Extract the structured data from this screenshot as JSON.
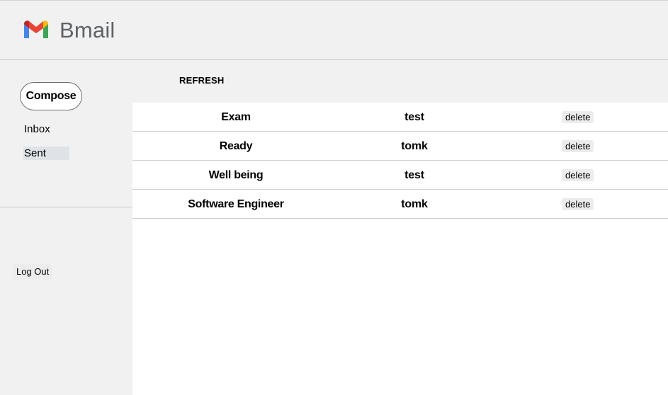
{
  "header": {
    "logo_icon": "gmail-m-icon",
    "app_title": "Bmail",
    "logo_colors": [
      "#4285f4",
      "#ea4335",
      "#fbbc04",
      "#34a853",
      "#c5221f"
    ]
  },
  "sidebar": {
    "compose_label": "Compose",
    "items": [
      {
        "label": "Inbox",
        "active": false
      },
      {
        "label": "Sent",
        "active": true
      }
    ],
    "logout_label": "Log Out"
  },
  "toolbar": {
    "refresh_label": "REFRESH"
  },
  "mails": [
    {
      "subject": "Exam",
      "sender": "test",
      "delete_label": "delete"
    },
    {
      "subject": "Ready",
      "sender": "tomk",
      "delete_label": "delete"
    },
    {
      "subject": "Well being",
      "sender": "test",
      "delete_label": "delete"
    },
    {
      "subject": "Software Engineer",
      "sender": "tomk",
      "delete_label": "delete"
    }
  ]
}
